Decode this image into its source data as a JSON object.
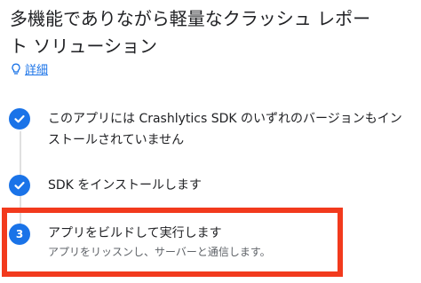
{
  "page": {
    "title": "多機能でありながら軽量なクラッシュ レポート ソリューション",
    "details_link": "詳細"
  },
  "steps": [
    {
      "state": "done",
      "icon": "check-icon",
      "label": "このアプリには Crashlytics SDK のいずれのバージョンもインストールされていません"
    },
    {
      "state": "done",
      "icon": "check-icon",
      "label": "SDK をインストールします"
    },
    {
      "state": "active",
      "number": "3",
      "label": "アプリをビルドして実行します",
      "sublabel": "アプリをリッスンし、サーバーと通信します。"
    }
  ],
  "colors": {
    "accent": "#1a73e8",
    "highlight_border": "#f23a1d",
    "rail": "#e0e0e0"
  }
}
